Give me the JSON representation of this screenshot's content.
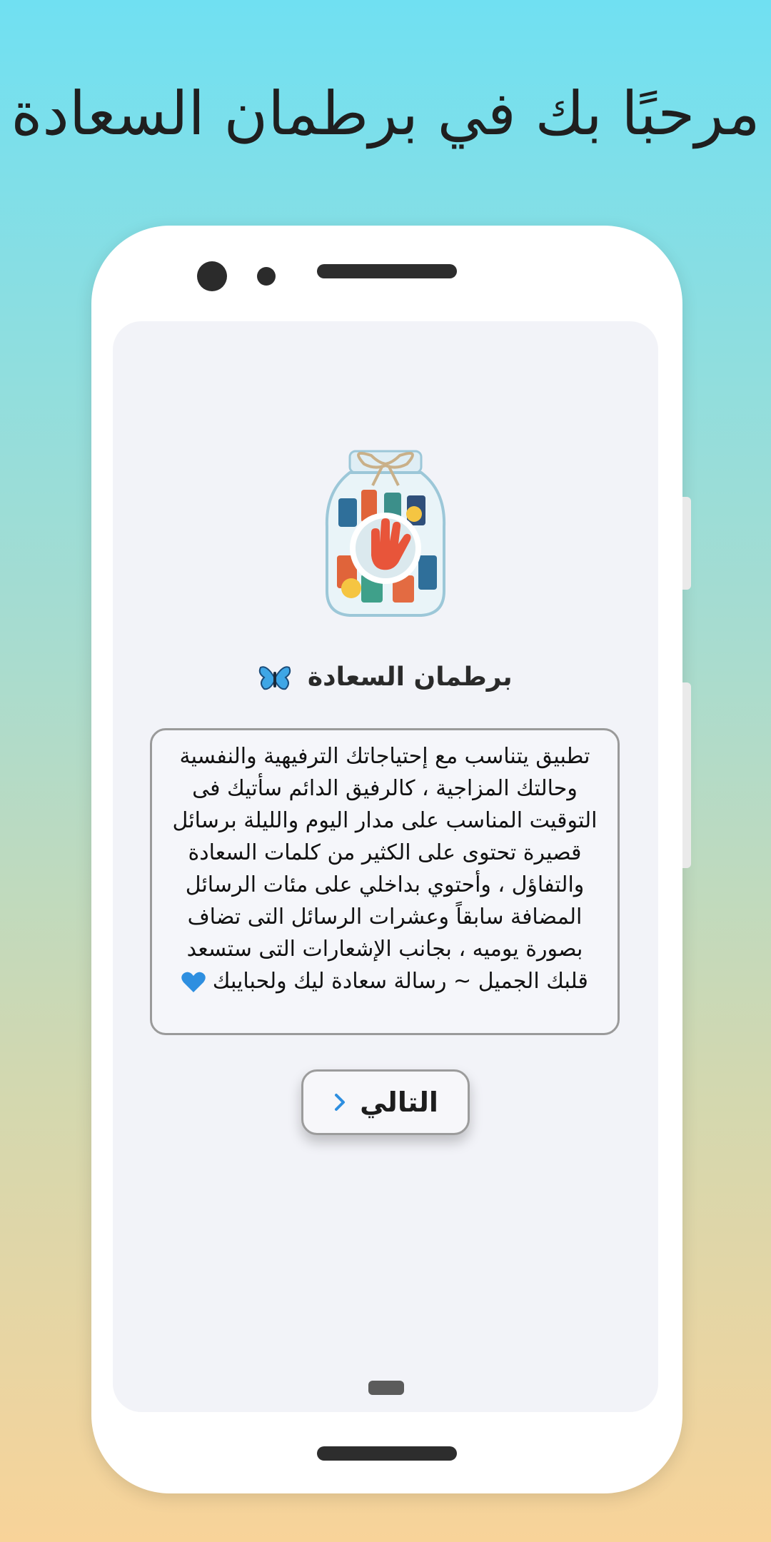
{
  "header": {
    "welcome_text": "مرحبًا بك في برطمان السعادة"
  },
  "app": {
    "title": "برطمان السعادة",
    "title_icon": "butterfly-icon",
    "description": "تطبيق يتناسب مع إحتياجاتك الترفيهية والنفسية وحالتك المزاجية ، كالرفيق الدائم سأتيك فى التوقيت المناسب على مدار اليوم والليلة برسائل قصيرة تحتوى على الكثير من كلمات السعادة والتفاؤل ، وأحتوي بداخلي على مئات الرسائل المضافة سابقاً وعشرات الرسائل التى تضاف بصورة يوميه ، بجانب الإشعارات التى ستسعد قلبك الجميل ~ رسالة سعادة ليك ولحبايبك",
    "description_icon": "blue-heart-icon",
    "next_button": {
      "label": "التالي",
      "icon": "chevron-right-icon"
    }
  },
  "colors": {
    "bg_top": "#70e0f2",
    "bg_bottom": "#f8d399",
    "screen_bg": "#f2f3f8",
    "heart": "#2e8fe0",
    "chevron": "#2e8fe0"
  }
}
